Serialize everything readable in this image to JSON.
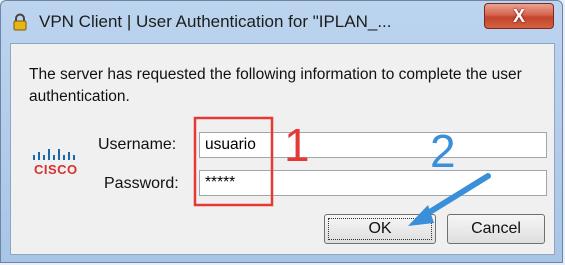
{
  "window": {
    "title": "VPN Client  |  User Authentication for \"IPLAN_...",
    "close_glyph": "X"
  },
  "dialog": {
    "message": "The server has requested the following information to complete the user authentication.",
    "logo_text": "CISCO",
    "username_label": "Username:",
    "username_value": "usuario",
    "password_label": "Password:",
    "password_value": "*****",
    "ok_label": "OK",
    "cancel_label": "Cancel"
  },
  "annotations": {
    "step_1": "1",
    "step_2": "2",
    "step_1_color": "#e53935",
    "step_2_color": "#3a8fd9"
  },
  "colors": {
    "titlebar": "#a9c5e6",
    "client_bg": "#f0f0f0",
    "cisco_red": "#d6312d",
    "cisco_blue": "#1b6aa8"
  }
}
